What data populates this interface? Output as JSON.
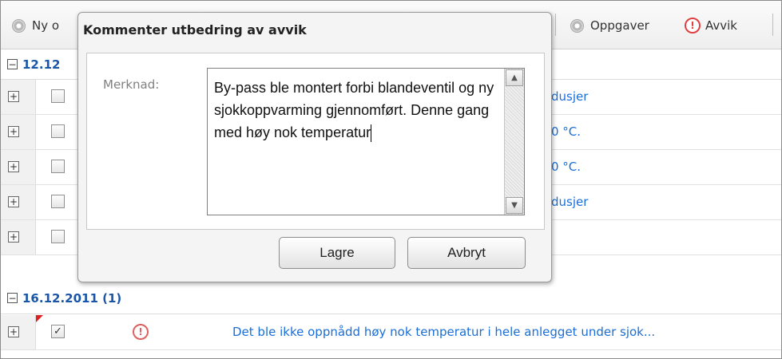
{
  "toolbar": {
    "new_label": "Ny o",
    "tasks_label": "Oppgaver",
    "deviations_label": "Avvik",
    "warn_glyph": "!"
  },
  "groups": [
    {
      "header": "12.12"
    },
    {
      "header": "16.12.2011 (1)"
    }
  ],
  "rows": [
    {
      "text": "dusjer"
    },
    {
      "text": "0 °C."
    },
    {
      "text": "0 °C."
    },
    {
      "text": "dusjer"
    },
    {
      "text": ""
    }
  ],
  "bottom_row": {
    "checked": "✓",
    "text": "Det ble ikke oppnådd høy nok temperatur i hele anlegget under sjok..."
  },
  "dialog": {
    "title": "Kommenter utbedring av avvik",
    "field_label": "Merknad:",
    "field_value": "By-pass ble montert forbi blandeventil og ny sjokkoppvarming gjennomført. Denne gang med høy nok temperatur",
    "save_label": "Lagre",
    "cancel_label": "Avbryt"
  },
  "icons": {
    "plus": "+",
    "minus": "−",
    "scroll_up": "▲",
    "scroll_down": "▼"
  },
  "colors": {
    "link": "#1a6ed8",
    "group_header": "#1a56a8",
    "warning": "#e04040"
  }
}
